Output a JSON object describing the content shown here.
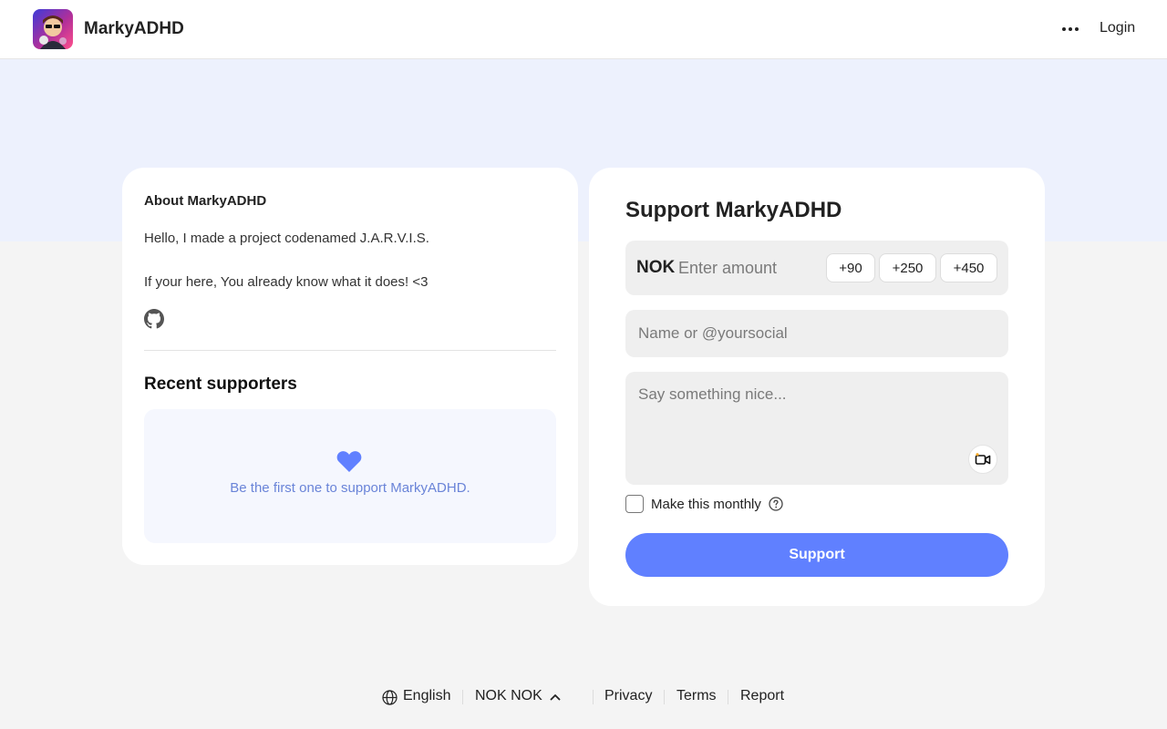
{
  "header": {
    "brand_name": "MarkyADHD",
    "login_label": "Login",
    "more_icon": "more-horizontal-icon"
  },
  "about": {
    "title": "About MarkyADHD",
    "paragraphs": [
      "Hello, I made a project codenamed J.A.R.V.I.S.",
      "If your here, You already know what it does! <3"
    ],
    "social_icon": "github-icon"
  },
  "recent": {
    "title": "Recent supporters",
    "empty_text": "Be the first one to support MarkyADHD.",
    "icon": "heart-icon"
  },
  "support": {
    "title": "Support MarkyADHD",
    "currency": "NOK",
    "amount_placeholder": "Enter amount",
    "quick_amounts": [
      "+90",
      "+250",
      "+450"
    ],
    "name_placeholder": "Name or @yoursocial",
    "message_placeholder": "Say something nice...",
    "monthly_label": "Make this monthly",
    "monthly_checked": false,
    "button_label": "Support"
  },
  "footer": {
    "language": "English",
    "currency_selector": "NOK NOK",
    "links": [
      "Privacy",
      "Terms",
      "Report"
    ]
  },
  "colors": {
    "accent": "#6080ff",
    "hero_band": "#edf1fd",
    "page_bg": "#f4f4f4",
    "recent_text": "#6a84d8"
  }
}
